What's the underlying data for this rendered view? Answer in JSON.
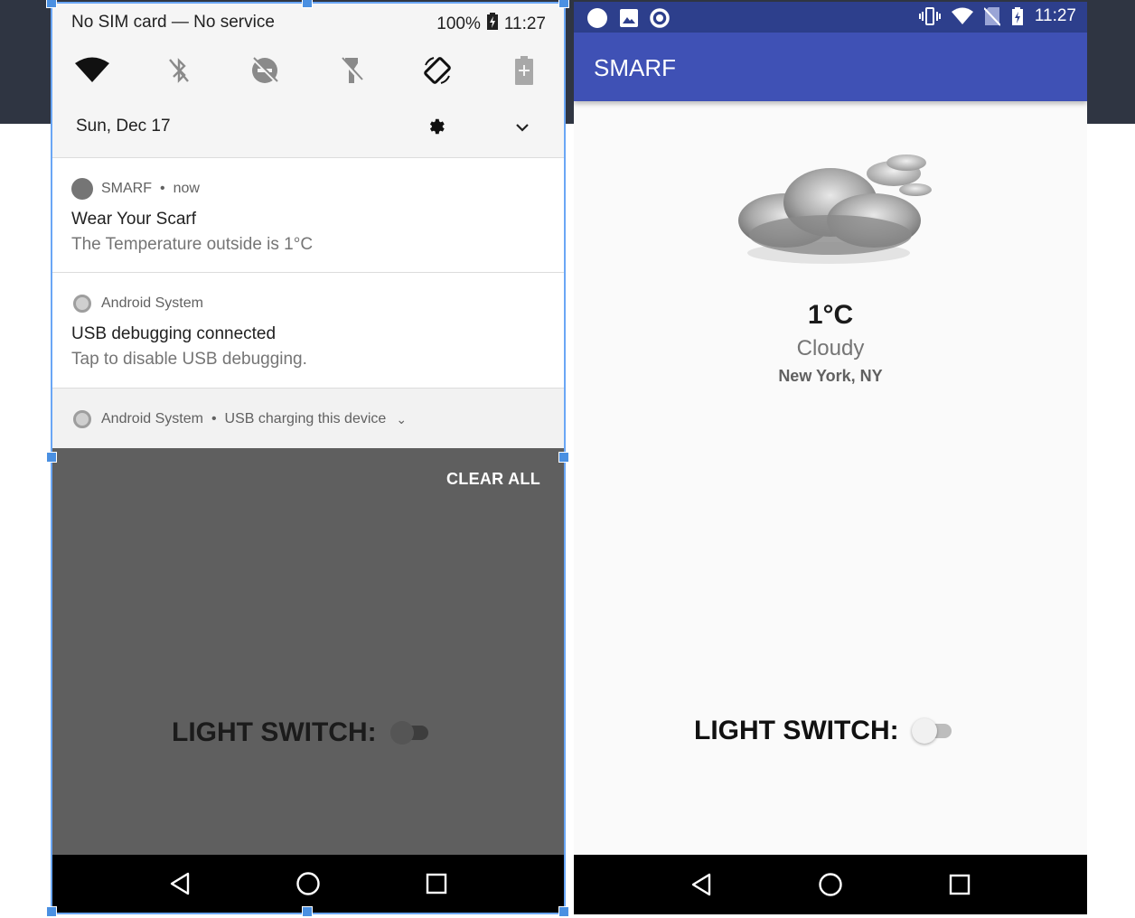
{
  "left_phone": {
    "quick_settings": {
      "carrier_status": "No SIM card — No service",
      "battery_percent": "100%",
      "time": "11:27",
      "date": "Sun, Dec 17",
      "tiles": [
        "wifi-icon",
        "bluetooth-off-icon",
        "do-not-disturb-icon",
        "flashlight-off-icon",
        "auto-rotate-icon",
        "battery-saver-icon"
      ]
    },
    "notifications": [
      {
        "app": "SMARF",
        "when": "now",
        "title": "Wear Your Scarf",
        "text": "The Temperature outside is 1°C"
      },
      {
        "app": "Android System",
        "title": "USB debugging connected",
        "text": "Tap to disable USB debugging."
      },
      {
        "app": "Android System",
        "summary": "USB charging this device"
      }
    ],
    "clear_all": "CLEAR ALL",
    "light_switch_label": "LIGHT SWITCH:"
  },
  "right_phone": {
    "time": "11:27",
    "app_title": "SMARF",
    "weather": {
      "temperature": "1°C",
      "condition": "Cloudy",
      "city": "New York, NY"
    },
    "light_switch_label": "LIGHT SWITCH:",
    "light_switch_on": false
  },
  "colors": {
    "app_bar": "#3f51b5",
    "status_bar": "#2d3f8c",
    "shade": "#5f5f5f"
  }
}
